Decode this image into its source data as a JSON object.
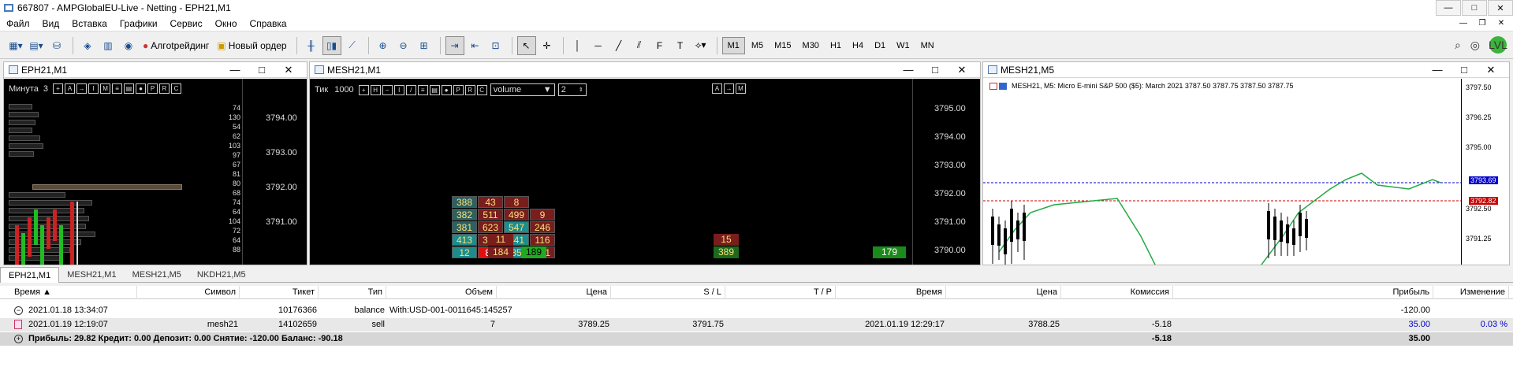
{
  "window": {
    "title": "667807 - AMPGlobalEU-Live - Netting - EPH21,M1"
  },
  "menu": [
    "Файл",
    "Вид",
    "Вставка",
    "Графики",
    "Сервис",
    "Окно",
    "Справка"
  ],
  "toolbar": {
    "algo_label": "Алгotрейдинг",
    "new_order_label": "Новый ордер",
    "timeframes": [
      "M1",
      "M5",
      "M15",
      "M30",
      "H1",
      "H4",
      "D1",
      "W1",
      "MN"
    ],
    "active_timeframe": "M1",
    "lvl": "LVL"
  },
  "chart1": {
    "title": "EPH21,M1",
    "timeframe_label": "Минута",
    "timeframe_value": "3",
    "prices": [
      "3794.00",
      "3793.00",
      "3792.00",
      "3791.00"
    ],
    "small_numbers": [
      "74",
      "130",
      "54",
      "62",
      "103",
      "97",
      "67",
      "81",
      "80",
      "68",
      "74",
      "64",
      "104",
      "72",
      "64",
      "88"
    ]
  },
  "chart2": {
    "title": "MESH21,M1",
    "tick_label": "Тик",
    "tick_value": "1000",
    "volume_select": "volume",
    "volume_num": "2",
    "prices": [
      "3795.00",
      "3794.00",
      "3793.00",
      "3792.00",
      "3791.00",
      "3790.00"
    ],
    "cells": [
      {
        "v": "388",
        "col": 0,
        "row": 0,
        "k": "up"
      },
      {
        "v": "382",
        "col": 0,
        "row": 1,
        "k": "up"
      },
      {
        "v": "381",
        "col": 0,
        "row": 2,
        "k": "up"
      },
      {
        "v": "413",
        "col": 0,
        "row": 3,
        "k": "teal"
      },
      {
        "v": "12",
        "col": 0,
        "row": 4,
        "k": "teal"
      },
      {
        "v": "43",
        "col": 1,
        "row": 0,
        "k": "red"
      },
      {
        "v": "511",
        "col": 1,
        "row": 1,
        "k": "red"
      },
      {
        "v": "623",
        "col": 1,
        "row": 2,
        "k": "red"
      },
      {
        "v": "351",
        "col": 1,
        "row": 3,
        "k": "red"
      },
      {
        "v": "84",
        "col": 1,
        "row": 4,
        "k": "bright"
      },
      {
        "v": "8",
        "col": 2,
        "row": 0,
        "k": "red"
      },
      {
        "v": "499",
        "col": 2,
        "row": 1,
        "k": "red"
      },
      {
        "v": "547",
        "col": 2,
        "row": 2,
        "k": "teal"
      },
      {
        "v": "441",
        "col": 2,
        "row": 3,
        "k": "teal"
      },
      {
        "v": "35",
        "col": 2,
        "row": 4,
        "k": "teal"
      },
      {
        "v": "9",
        "col": 3,
        "row": 1,
        "k": "red"
      },
      {
        "v": "246",
        "col": 3,
        "row": 2,
        "k": "red"
      },
      {
        "v": "116",
        "col": 3,
        "row": 3,
        "k": "red"
      },
      {
        "v": "121",
        "col": 3,
        "row": 4,
        "k": "red"
      }
    ],
    "left_cells": [
      {
        "v": "11"
      },
      {
        "v": "184"
      }
    ],
    "green_cell": "189",
    "right_cells": [
      {
        "v": "15"
      },
      {
        "v": "389"
      }
    ],
    "far_right": "179"
  },
  "chart3": {
    "title": "MESH21,M5",
    "info": "MESH21, M5:  Micro E-mini S&P 500 ($5): March 2021  3787.50 3787.75 3787.50 3787.75",
    "prices": [
      "3797.50",
      "3796.25",
      "3795.00",
      "3792.50",
      "3791.25"
    ],
    "blue_line": "3793.69",
    "red_line": "3792.82"
  },
  "tabs": [
    "EPH21,M1",
    "MESH21,M1",
    "MESH21,M5",
    "NKDH21,M5"
  ],
  "active_tab": "EPH21,M1",
  "table": {
    "headers": [
      "Время",
      "Символ",
      "Тикет",
      "Тип",
      "Объем",
      "Цена",
      "S / L",
      "T / P",
      "Время",
      "Цена",
      "Комиссия",
      "Прибыль",
      "Изменение"
    ],
    "rows": [
      {
        "time": "2021.01.18 13:34:07",
        "symbol": "",
        "ticket": "10176366",
        "type": "balance",
        "comment": "With:USD-001-0011645:145257",
        "profit": "-120.00"
      },
      {
        "time": "2021.01.19 12:19:07",
        "symbol": "mesh21",
        "ticket": "14102659",
        "type": "sell",
        "volume": "7",
        "price": "3789.25",
        "sl": "3791.75",
        "tp": "",
        "time2": "2021.01.19 12:29:17",
        "price2": "3788.25",
        "commission": "-5.18",
        "profit": "35.00",
        "change": "0.03 %"
      }
    ],
    "summary": {
      "text": "Прибыль: 29.82  Кредит: 0.00  Депозит: 0.00  Снятие: -120.00  Баланс: -90.18",
      "commission": "-5.18",
      "profit": "35.00"
    }
  }
}
